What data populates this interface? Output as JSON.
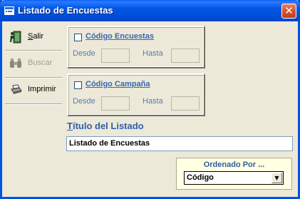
{
  "window": {
    "title": "Listado de Encuestas",
    "close_glyph": "✕"
  },
  "toolbar": {
    "items": [
      {
        "label": "Salir",
        "icon": "exit-door-icon",
        "enabled": true
      },
      {
        "label": "Buscar",
        "icon": "binoculars-icon",
        "enabled": false
      },
      {
        "label": "Imprimir",
        "icon": "printer-icon",
        "enabled": true
      }
    ]
  },
  "filters": {
    "encuestas": {
      "label": "Código Encuestas",
      "checked": false,
      "from_label": "Desde",
      "from_value": "",
      "to_label": "Hasta",
      "to_value": ""
    },
    "campana": {
      "label": "Código Campaña",
      "checked": false,
      "from_label": "Desde",
      "from_value": "",
      "to_label": "Hasta",
      "to_value": ""
    }
  },
  "listing": {
    "title_label": "Título del Listado",
    "title_value": "Listado de Encuestas"
  },
  "order": {
    "label": "Ordenado Por ...",
    "selected": "Código"
  },
  "colors": {
    "titlebar": "#0054e3",
    "accent_text": "#2f5ea8",
    "order_background": "#ffffe1"
  }
}
